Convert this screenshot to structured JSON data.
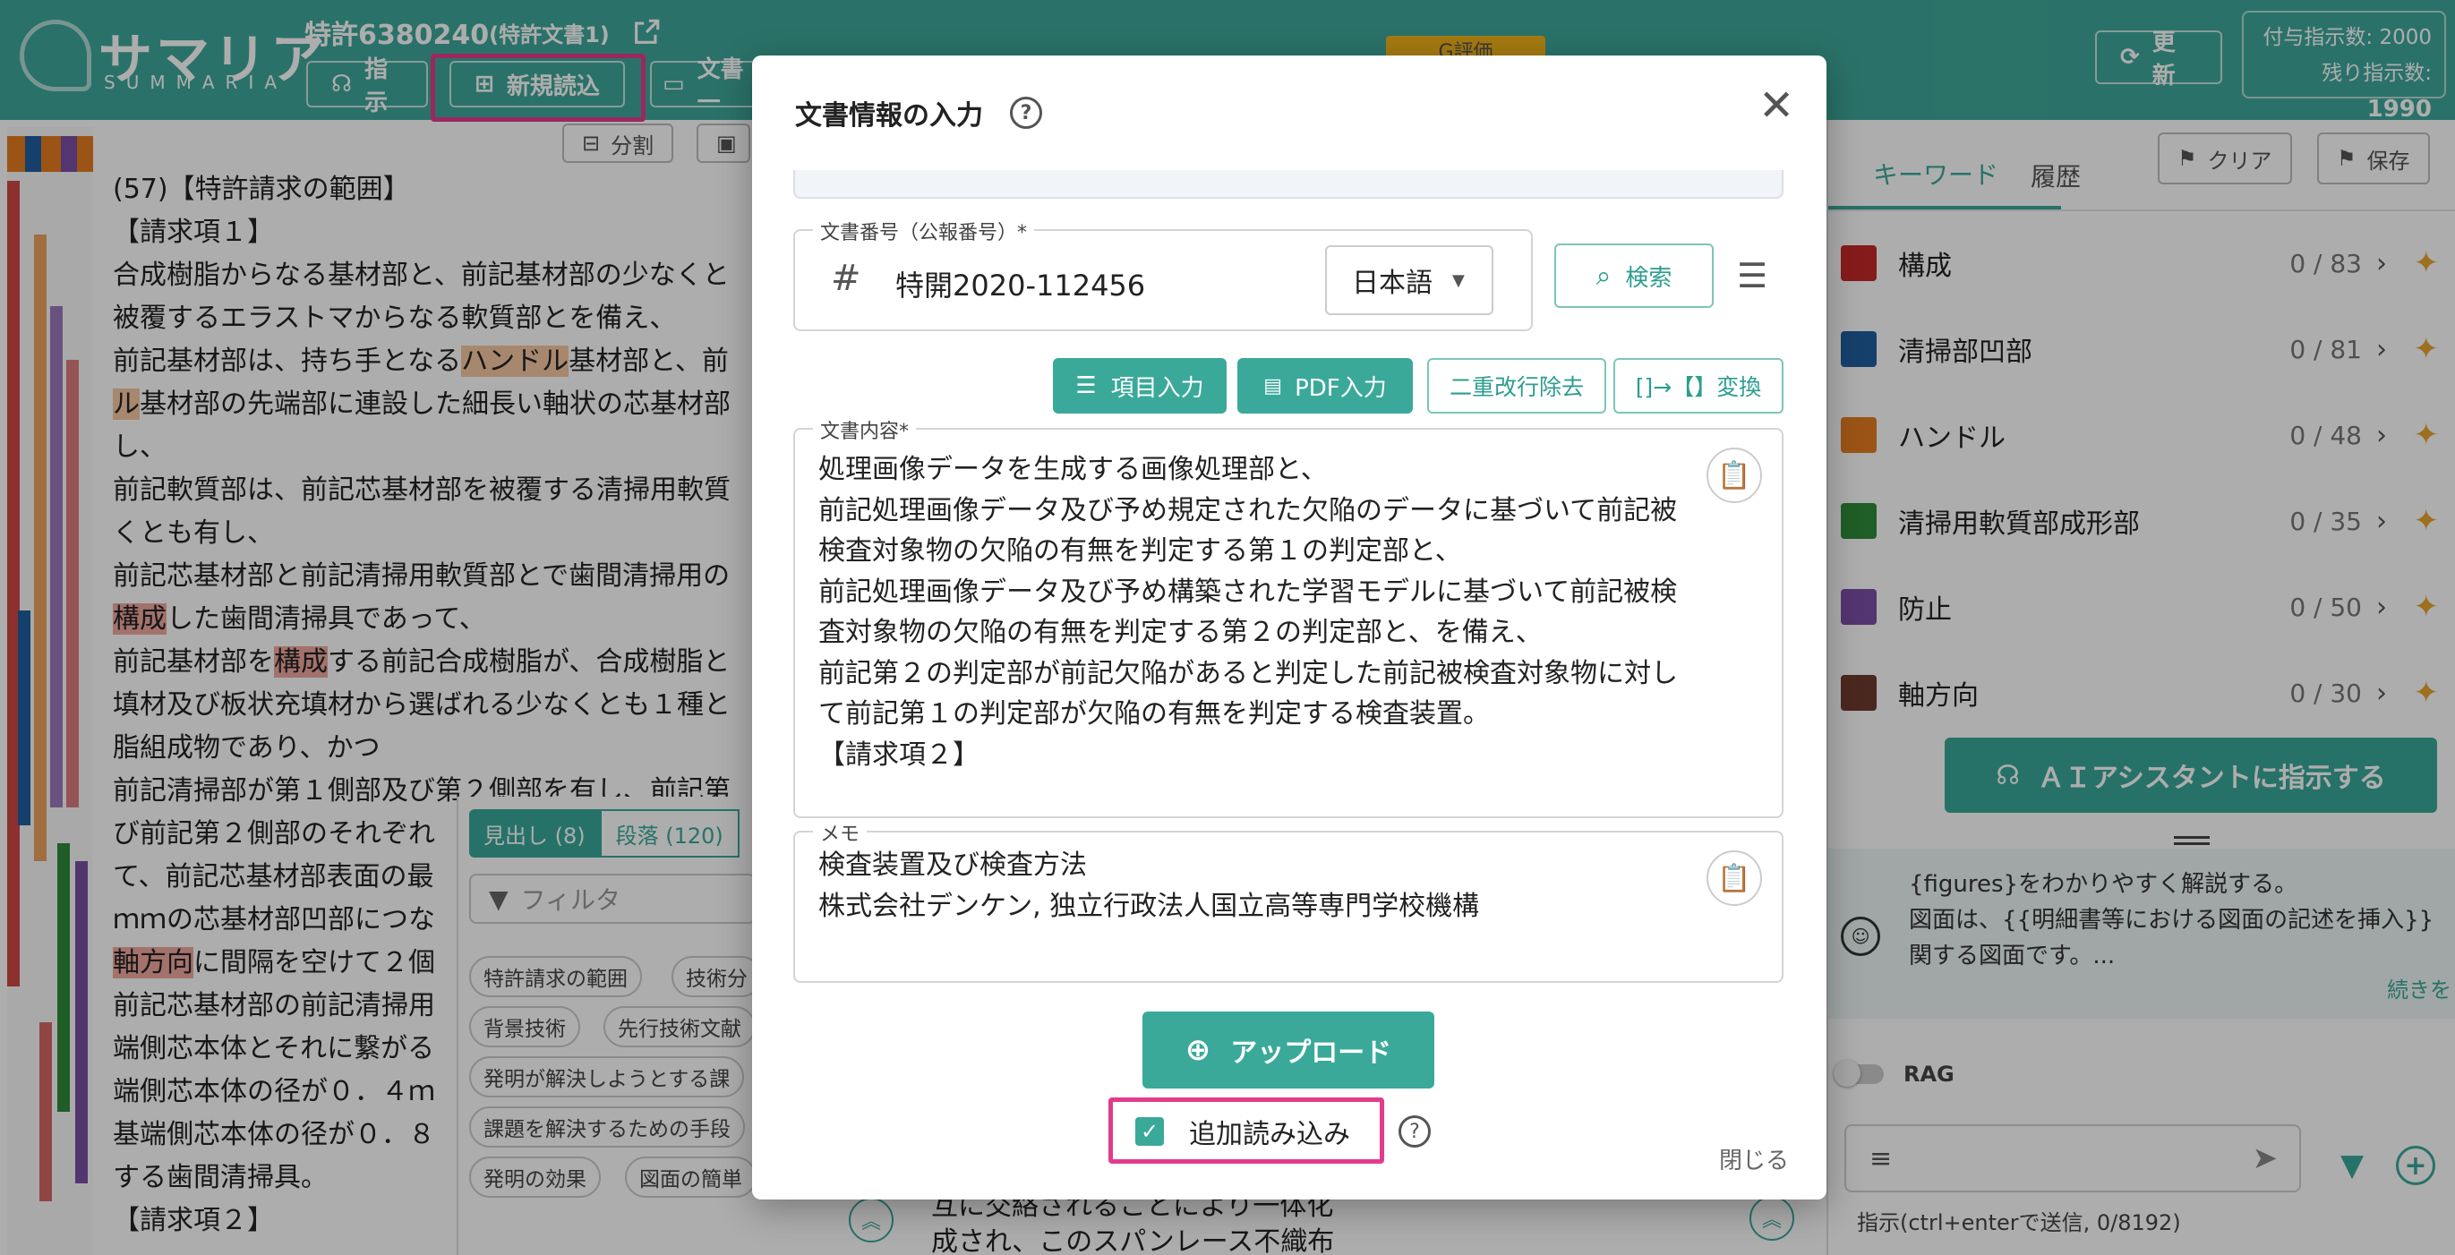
{
  "header": {
    "logo_jp": "サマリア",
    "logo_en": "SUMMARIA",
    "patent_title": "特許6380240",
    "patent_subtitle": "(特許文書1)",
    "btn_instruct": "指示",
    "btn_new_load": "新規読込",
    "btn_doc_partial": "文書一",
    "g_eval_partial": "G評価",
    "btn_update": "更新",
    "counter_given_label": "付与指示数:",
    "counter_given_value": "2000",
    "counter_remaining_label": "残り指示数:",
    "counter_remaining_value": "1990"
  },
  "left": {
    "toolbar_split": "分割",
    "lines": [
      [
        "(57)【特許請求の範囲】"
      ],
      [
        "【請求項１】"
      ],
      [
        "合成樹脂からなる基材部と、前記基材部の少なくと"
      ],
      [
        "被覆するエラストマからなる軟質部とを備え、"
      ],
      [
        "前記基材部は、持ち手となる",
        "ハンドル",
        "基材部と、前"
      ],
      [
        "ル",
        "基材部の先端部に連設した細長い軸状の芯基材部"
      ],
      [
        "し、"
      ],
      [
        "前記軟質部は、前記芯基材部を被覆する清掃用軟質"
      ],
      [
        "くとも有し、"
      ],
      [
        "前記芯基材部と前記清掃用軟質部とで歯間清掃用の"
      ],
      [
        "構成",
        "した歯間清掃具であって、"
      ],
      [
        "前記基材部を",
        "構成",
        "する前記合成樹脂が、合成樹脂と"
      ],
      [
        "填材及び板状充填材から選ばれる少なくとも１種と"
      ],
      [
        "脂組成物であり、かつ"
      ],
      [
        "前記清掃部が第１側部及び第２側部を有し、前記第"
      ],
      [
        "び前記第２側部のそれぞれ"
      ],
      [
        "て、前記芯基材部表面の最"
      ],
      [
        "ｍｍの芯基材部凹部につな"
      ],
      [
        "軸方向",
        "に間隔を空けて２個"
      ],
      [
        "前記芯基材部の前記清掃用"
      ],
      [
        "端側芯本体とそれに繋がる"
      ],
      [
        "端側芯本体の径が０．４ｍ"
      ],
      [
        "基端側芯本体の径が０．８"
      ],
      [
        "する歯間清掃具。"
      ],
      [
        "【請求項２】"
      ]
    ],
    "mid_tab_headings": "見出し (8)",
    "mid_tab_paragraphs": "段落 (120)",
    "filter_placeholder": "フィルタ",
    "chips": [
      "特許請求の範囲",
      "技術分",
      "背景技術",
      "先行技術文献",
      "発明が解決しようとする課",
      "課題を解決するための手段",
      "発明の効果",
      "図面の簡単"
    ],
    "bottom_text_1": "互に交絡されることにより一体化",
    "bottom_text_2": "成され、このスパンレース不織布"
  },
  "right": {
    "tab_keyword": "キーワード",
    "tab_history": "履歴",
    "btn_clear": "クリア",
    "btn_save": "保存",
    "keywords": [
      {
        "label": "構成",
        "count": "0 / 83",
        "color": "#c62828"
      },
      {
        "label": "清掃部凹部",
        "count": "0 / 81",
        "color": "#1f5f9e"
      },
      {
        "label": "ハンドル",
        "count": "0 / 48",
        "color": "#e57c1f"
      },
      {
        "label": "清掃用軟質部成形部",
        "count": "0 / 35",
        "color": "#2e8b3a"
      },
      {
        "label": "防止",
        "count": "0 / 50",
        "color": "#7b4fa6"
      },
      {
        "label": "軸方向",
        "count": "0 / 30",
        "color": "#6d3b2e"
      }
    ],
    "ai_button": "ＡＩアシスタントに指示する",
    "assistant_line1": "{figures}をわかりやすく解説する。",
    "assistant_line2": "図面は、{{明細書等における図面の記述を挿入}}",
    "assistant_line3": "関する図面です。...",
    "read_more": "続きを",
    "rag_label": "RAG",
    "hint": "指示(ctrl+enterで送信, 0/8192)"
  },
  "modal": {
    "title": "文書情報の入力",
    "doc_number_label": "文書番号（公報番号）*",
    "doc_number_value": "特開2020-112456",
    "language": "日本語",
    "search_btn": "検索",
    "btn_item_input": "項目入力",
    "btn_pdf_input": "PDF入力",
    "btn_remove_double": "二重改行除去",
    "btn_convert": "[]→【】変換",
    "content_label": "文書内容*",
    "content_lines": [
      "処理画像データを生成する画像処理部と、",
      "前記処理画像データ及び予め規定された欠陥のデータに基づいて前記被",
      "検査対象物の欠陥の有無を判定する第１の判定部と、",
      "前記処理画像データ及び予め構築された学習モデルに基づいて前記被検",
      "査対象物の欠陥の有無を判定する第２の判定部と、を備え、",
      "前記第２の判定部が前記欠陥があると判定した前記被検査対象物に対し",
      "て前記第１の判定部が欠陥の有無を判定する検査装置。",
      "【請求項２】"
    ],
    "memo_label": "メモ",
    "memo_lines": [
      "検査装置及び検査方法",
      "株式会社デンケン, 独立行政法人国立高等専門学校機構"
    ],
    "upload_btn": "アップロード",
    "additional_load": "追加読み込み",
    "close": "閉じる"
  },
  "colors": {
    "accent": "#3aa99a",
    "highlight_box": "#e33b8c"
  }
}
